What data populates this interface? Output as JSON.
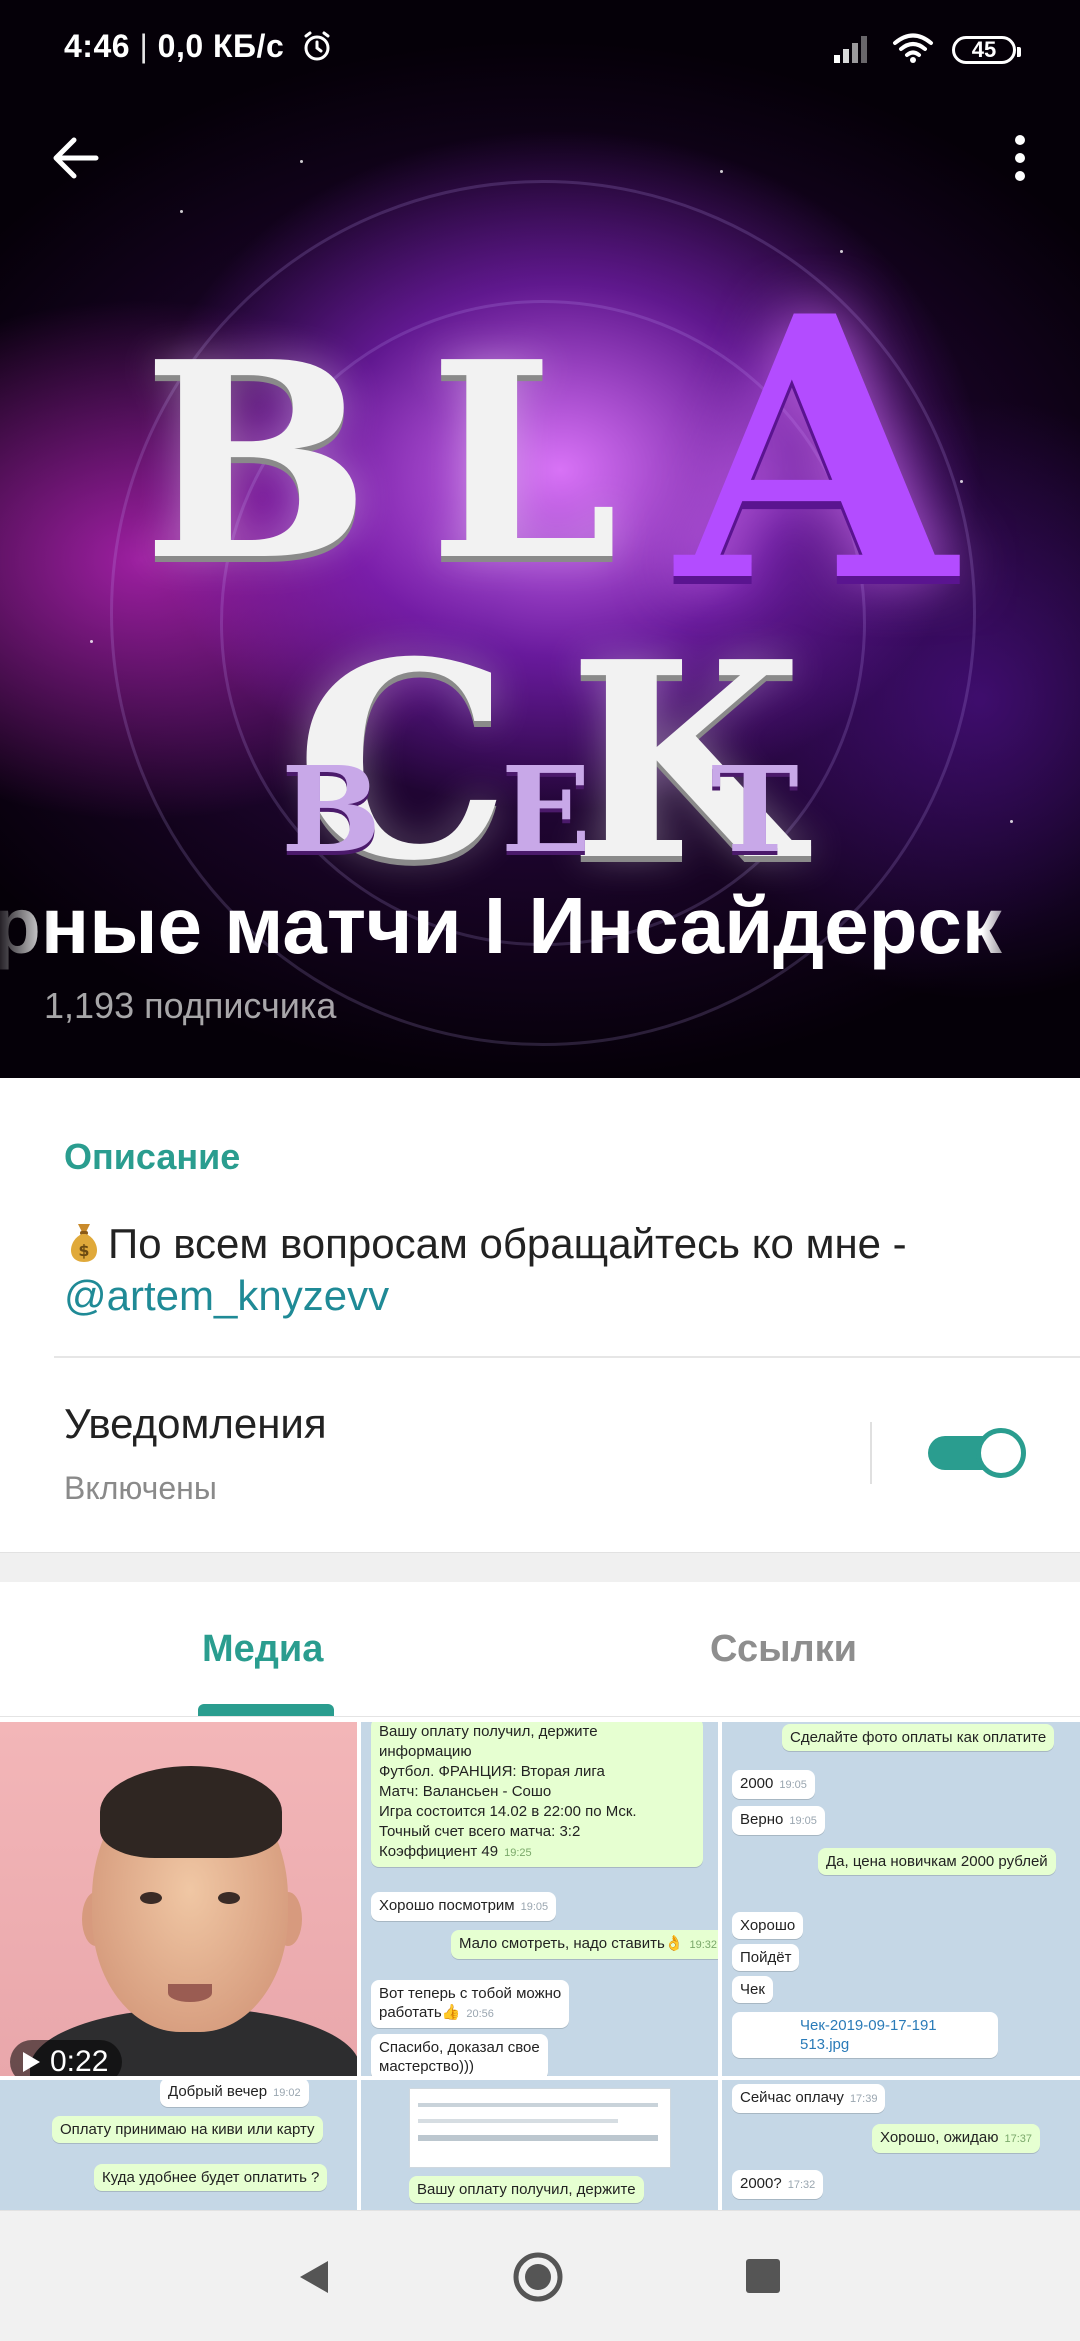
{
  "status_bar": {
    "time": "4:46",
    "network_speed": "0,0 КБ/с",
    "battery": "45"
  },
  "header": {
    "logo_main": "BLACK",
    "logo_sub": "BET",
    "channel_title": "рные матчи I Инсайдерск",
    "subscribers": "1,193 подписчика"
  },
  "description": {
    "header": "Описание",
    "text": "По всем вопросам обращайтесь ко мне -",
    "link": "@artem_knyzevv"
  },
  "notifications": {
    "label": "Уведомления",
    "status": "Включены",
    "enabled": true
  },
  "tabs": {
    "media": "Медиа",
    "links": "Ссылки",
    "active": "media"
  },
  "media": {
    "video_duration": "0:22",
    "chat1": {
      "m1": "Вашу оплату получил, держите",
      "m2": "информацию",
      "m3": "Футбол. ФРАНЦИЯ: Вторая лига",
      "m4": "Матч: Валансьен - Сошо",
      "m5": "Игра состоится 14.02 в 22:00 по Мск.",
      "m6": "Точный счет всего матча: 3:2",
      "m7": "Коэффициент 49",
      "m8": "Хорошо посмотрим",
      "m9": "Мало смотреть, надо ставить👌",
      "m10": "Вот теперь с тобой можно",
      "m11": "работать👍",
      "m12": "Спасибо, доказал свое",
      "m13": "мастерство)))"
    },
    "chat2": {
      "m1": "Сделайте фото оплаты как оплатите",
      "m2": "2000",
      "m3": "Верно",
      "m4": "Да, цена новичкам 2000 рублей",
      "m5": "Хорошо",
      "m6": "Пойдёт",
      "m7": "Чек",
      "m8": "Чек-2019-09-17-191",
      "m9": "513.jpg"
    },
    "chat3": {
      "m1": "Добрый вечер",
      "m2": "Оплату принимаю на киви или карту",
      "m3": "Куда удобнее будет оплатить ?"
    },
    "chat4": {
      "m1": "Вашу оплату получил, держите"
    },
    "chat5": {
      "m1": "Сейчас оплачу",
      "m2": "Хорошо, ожидаю",
      "m3": "2000?"
    },
    "times": {
      "t1": "19:25",
      "t2": "19:05",
      "t3": "19:32",
      "t4": "20:56",
      "t5": "17:39",
      "t6": "17:37",
      "t7": "17:32",
      "t8": "19:02"
    }
  },
  "colors": {
    "accent": "#2a9d8f",
    "link": "#1f8a96",
    "cover_purple": "#b34cff"
  },
  "icons": {
    "back": "arrow-left-icon",
    "more": "more-vertical-icon",
    "alarm": "alarm-icon",
    "signal": "signal-icon",
    "wifi": "wifi-icon",
    "money_bag": "money-bag-icon",
    "play": "play-icon",
    "nav_back": "triangle-back-icon",
    "nav_home": "circle-home-icon",
    "nav_recent": "square-recent-icon"
  }
}
